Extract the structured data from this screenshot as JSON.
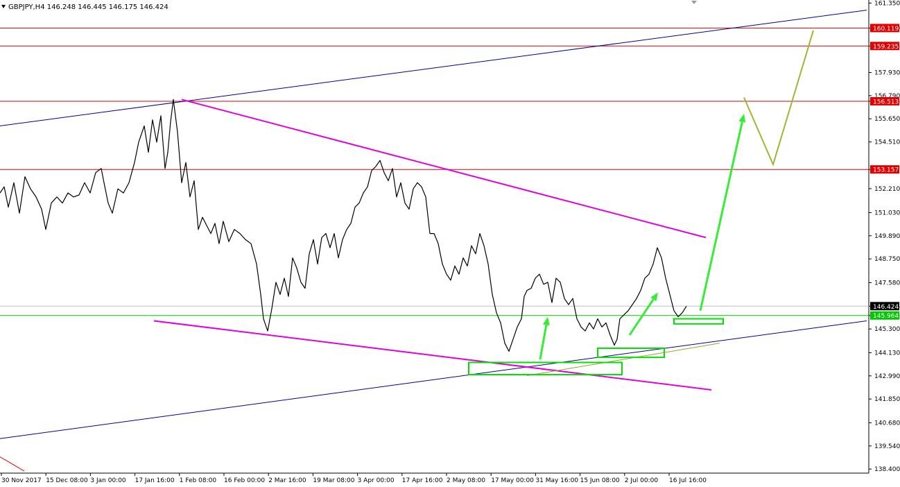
{
  "header": {
    "symbol_line": "GBPJPY,H4  146.248 146.445 146.175 146.424"
  },
  "chart_data": {
    "type": "line",
    "symbol": "GBPJPY",
    "timeframe": "H4",
    "ohlc_last": {
      "open": 146.248,
      "high": 146.445,
      "low": 146.175,
      "close": 146.424
    },
    "ylim": [
      138.2,
      161.5
    ],
    "y_ticks": [
      "161.350",
      "160.119",
      "159.235",
      "157.930",
      "156.790",
      "156.513",
      "155.650",
      "154.510",
      "153.157",
      "152.210",
      "151.030",
      "149.890",
      "148.750",
      "147.580",
      "146.424",
      "145.964",
      "145.300",
      "144.130",
      "142.990",
      "141.850",
      "140.680",
      "139.540",
      "138.400"
    ],
    "x_ticks": [
      "30 Nov 2017",
      "15 Dec 08:00",
      "3 Jan 00:00",
      "17 Jan 16:00",
      "1 Feb 08:00",
      "16 Feb 00:00",
      "2 Mar 16:00",
      "19 Mar 08:00",
      "3 Apr 00:00",
      "17 Apr 16:00",
      "2 May 08:00",
      "17 May 00:00",
      "31 May 16:00",
      "15 Jun 08:00",
      "2 Jul 00:00",
      "16 Jul 16:00"
    ],
    "price_series": {
      "name": "",
      "x": [
        0,
        6,
        12,
        20,
        28,
        36,
        44,
        52,
        60,
        66,
        74,
        82,
        90,
        98,
        106,
        114,
        122,
        130,
        138,
        146,
        150,
        156,
        162,
        170,
        178,
        186,
        194,
        200,
        208,
        214,
        220,
        226,
        232,
        238,
        242,
        246,
        250,
        256,
        262,
        268,
        274,
        280,
        286,
        292,
        298,
        304,
        310,
        316,
        322,
        330,
        338,
        346,
        354,
        362,
        370,
        376,
        380,
        386,
        392,
        398,
        404,
        410,
        416,
        422,
        428,
        434,
        440,
        446,
        452,
        458,
        464,
        470,
        476,
        482,
        488,
        494,
        500,
        506,
        512,
        518,
        524,
        530,
        536,
        542,
        548,
        554,
        560,
        566,
        572,
        578,
        584,
        590,
        596,
        602,
        608,
        614,
        620,
        626,
        632,
        638,
        644,
        650,
        656,
        662,
        668,
        674,
        680,
        686,
        692,
        698,
        704,
        710,
        716,
        722,
        728,
        734,
        740,
        746,
        752,
        756,
        760,
        766,
        772,
        778,
        784,
        790,
        796,
        802,
        808,
        814,
        820,
        826,
        832,
        838,
        844,
        850,
        856,
        862,
        868,
        874,
        880,
        886,
        890,
        894,
        900,
        906,
        912,
        918,
        924,
        930,
        936,
        942,
        948,
        954,
        960,
        966,
        972,
        978,
        984,
        990,
        996,
        1002
      ],
      "y": [
        152.0,
        152.3,
        151.3,
        152.5,
        151.0,
        152.8,
        152.2,
        151.8,
        151.2,
        150.2,
        151.5,
        151.8,
        151.5,
        152.0,
        151.8,
        151.9,
        152.5,
        152.0,
        153.0,
        153.2,
        152.5,
        151.5,
        151.0,
        152.2,
        152.0,
        152.5,
        153.5,
        154.5,
        155.3,
        154.0,
        155.6,
        154.5,
        155.8,
        153.2,
        154.0,
        155.5,
        156.6,
        155.0,
        152.5,
        153.5,
        151.8,
        152.6,
        150.2,
        150.8,
        150.4,
        150.0,
        150.5,
        149.5,
        150.6,
        149.6,
        150.2,
        150.0,
        149.7,
        149.5,
        148.5,
        147.0,
        145.8,
        145.2,
        146.3,
        147.6,
        147.0,
        147.8,
        146.9,
        148.8,
        148.3,
        147.6,
        147.3,
        149.0,
        149.7,
        148.5,
        149.8,
        150.0,
        149.3,
        150.0,
        148.8,
        149.7,
        150.2,
        150.5,
        151.3,
        151.5,
        152.0,
        152.3,
        153.1,
        153.3,
        153.6,
        153.0,
        152.6,
        153.2,
        151.8,
        152.5,
        151.5,
        151.2,
        152.2,
        152.5,
        152.3,
        151.8,
        150.0,
        150.0,
        149.5,
        148.5,
        148.0,
        147.7,
        148.4,
        148.0,
        148.8,
        148.4,
        149.4,
        149.0,
        150.0,
        149.4,
        148.5,
        147.0,
        146.1,
        145.6,
        144.6,
        144.2,
        144.8,
        145.4,
        145.8,
        146.9,
        147.2,
        147.3,
        147.8,
        148.0,
        147.5,
        147.6,
        146.6,
        147.8,
        147.6,
        146.8,
        146.5,
        146.8,
        145.8,
        145.4,
        145.2,
        145.6,
        145.3,
        145.8,
        145.4,
        145.6,
        145.0,
        144.5,
        144.8,
        145.8,
        146.0,
        146.2,
        146.5,
        146.8,
        147.2,
        147.8,
        148.0,
        148.5,
        149.3,
        148.8,
        147.8,
        147.0,
        146.2,
        145.9,
        146.1,
        146.424
      ]
    },
    "horizontal_levels": [
      {
        "price": 160.119,
        "label": "160.119",
        "color": "#e00000"
      },
      {
        "price": 159.235,
        "label": "159.235",
        "color": "#e00000"
      },
      {
        "price": 156.513,
        "label": "156.513",
        "color": "#e00000"
      },
      {
        "price": 153.157,
        "label": "153.157",
        "color": "#e00000"
      },
      {
        "price": 145.964,
        "label": "145.964",
        "color": "#00c800"
      },
      {
        "price": 146.424,
        "label": "146.424",
        "color": "#000000"
      }
    ],
    "trendlines": [
      {
        "name": "",
        "color": "#000090",
        "from": [
          0,
          155.3
        ],
        "to": [
          1250,
          161.0
        ]
      },
      {
        "name": "",
        "color": "#000090",
        "from": [
          0,
          139.9
        ],
        "to": [
          1250,
          145.7
        ]
      },
      {
        "name": "",
        "color": "#e000e0",
        "from": [
          262,
          156.6
        ],
        "to": [
          1018,
          149.8
        ]
      },
      {
        "name": "",
        "color": "#e000e0",
        "from": [
          222,
          145.7
        ],
        "to": [
          1026,
          142.3
        ]
      },
      {
        "name": "",
        "color": "#e00000",
        "from": [
          0,
          139.0
        ],
        "to": [
          35,
          138.3
        ]
      },
      {
        "name": "",
        "color": "#8aaa20",
        "from": [
          760,
          143.0
        ],
        "to": [
          1038,
          144.6
        ]
      }
    ],
    "support_boxes": [
      {
        "x1": 676,
        "x2": 897,
        "y1": 143.65,
        "y2": 143.05,
        "color": "#00e000"
      },
      {
        "x1": 862,
        "x2": 958,
        "y1": 144.35,
        "y2": 143.9,
        "color": "#00e000"
      },
      {
        "x1": 972,
        "x2": 1043,
        "y1": 145.8,
        "y2": 145.55,
        "color": "#00e000"
      }
    ],
    "arrows": [
      {
        "color": "#33ee33",
        "from": [
          779,
          143.8
        ],
        "to": [
          790,
          145.9
        ]
      },
      {
        "color": "#33ee33",
        "from": [
          908,
          145.0
        ],
        "to": [
          949,
          147.1
        ]
      },
      {
        "color": "#33ee33",
        "from": [
          1010,
          146.2
        ],
        "to": [
          1073,
          155.9
        ]
      }
    ],
    "projection_path": {
      "color": "#9ab830",
      "points": [
        [
          1073,
          156.7
        ],
        [
          1115,
          153.4
        ],
        [
          1173,
          160.0
        ]
      ]
    },
    "grid": false,
    "legend": "none",
    "colors": {
      "price": "#000000",
      "resistance": "#e00000",
      "support": "#00c800",
      "arrow": "#33ee33",
      "projection": "#9ab830"
    }
  }
}
